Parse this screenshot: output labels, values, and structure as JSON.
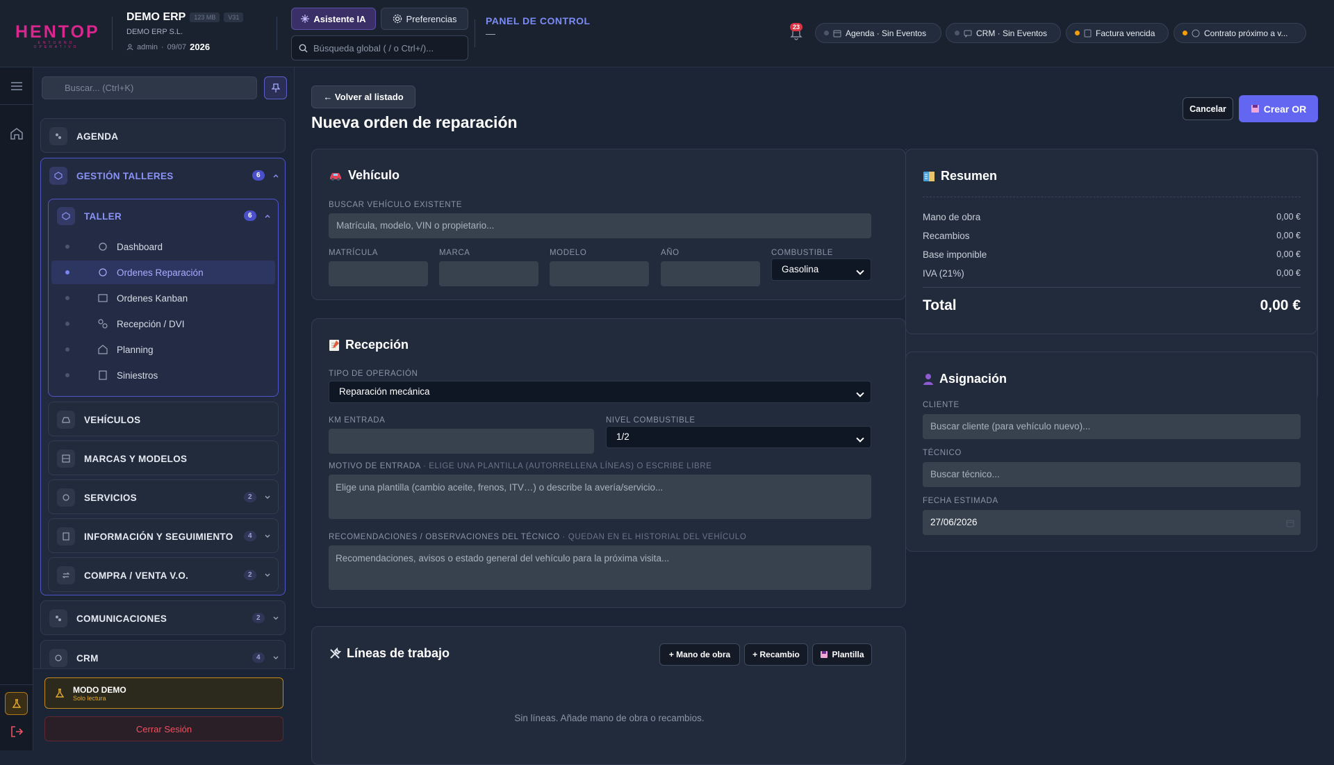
{
  "brand": {
    "logo": "HENTOP",
    "tagline": "ENTORNO OPERATIVO"
  },
  "erp": {
    "name": "DEMO ERP",
    "memory": "123 MB",
    "version": "V31",
    "company": "DEMO ERP S.L.",
    "user": "admin",
    "date": "09/07",
    "year": "2026"
  },
  "topbar": {
    "ai_button": "Asistente IA",
    "pref_button": "Preferencias",
    "search_placeholder": "Búsqueda global ( / o Ctrl+/)...",
    "panel_title": "PANEL DE CONTROL",
    "panel_sub": "—",
    "notifications": "23",
    "pills": [
      {
        "label": "Agenda · Sin Eventos",
        "dot": "#4c566a"
      },
      {
        "label": "CRM · Sin Eventos",
        "dot": "#4c566a"
      },
      {
        "label": "Factura vencida",
        "dot": "#f59e0b"
      },
      {
        "label": "Contrato próximo a v...",
        "dot": "#f59e0b"
      }
    ]
  },
  "sidebar": {
    "search_placeholder": "Buscar... (Ctrl+K)",
    "agenda": "AGENDA",
    "gestion": {
      "label": "GESTIÓN TALLERES",
      "count": "6"
    },
    "taller": {
      "label": "TALLER",
      "count": "6"
    },
    "taller_items": [
      "Dashboard",
      "Ordenes Reparación",
      "Ordenes Kanban",
      "Recepción / DVI",
      "Planning",
      "Siniestros"
    ],
    "vehiculos": "VEHÍCULOS",
    "marcas": "MARCAS Y MODELOS",
    "servicios": {
      "label": "SERVICIOS",
      "count": "2"
    },
    "informacion": {
      "label": "INFORMACIÓN Y SEGUIMIENTO",
      "count": "4"
    },
    "compraventa": {
      "label": "COMPRA / VENTA V.O.",
      "count": "2"
    },
    "comunicaciones": {
      "label": "COMUNICACIONES",
      "count": "2"
    },
    "crm": {
      "label": "CRM",
      "count": "4"
    },
    "demo_title": "MODO DEMO",
    "demo_sub": "Solo lectura",
    "logout": "Cerrar Sesión"
  },
  "main": {
    "back": "← Volver al listado",
    "title": "Nueva orden de reparación",
    "cancel": "Cancelar",
    "create": "Crear OR"
  },
  "vehiculo": {
    "title": "Vehículo",
    "search_label": "BUSCAR VEHÍCULO EXISTENTE",
    "search_placeholder": "Matrícula, modelo, VIN o propietario...",
    "matricula": "MATRÍCULA",
    "marca": "MARCA",
    "modelo": "MODELO",
    "anio": "AÑO",
    "combustible": "COMBUSTIBLE",
    "combustible_value": "Gasolina"
  },
  "recepcion": {
    "title": "Recepción",
    "tipo_label": "TIPO DE OPERACIÓN",
    "tipo_value": "Reparación mecánica",
    "km_label": "KM ENTRADA",
    "nivel_label": "NIVEL COMBUSTIBLE",
    "nivel_value": "1/2",
    "motivo_label": "MOTIVO DE ENTRADA",
    "motivo_hint": "· ELIGE UNA PLANTILLA (AUTORRELLENA LÍNEAS) O ESCRIBE LIBRE",
    "motivo_placeholder": "Elige una plantilla (cambio aceite, frenos, ITV…) o describe la avería/servicio...",
    "reco_label": "RECOMENDACIONES / OBSERVACIONES DEL TÉCNICO",
    "reco_hint": "· QUEDAN EN EL HISTORIAL DEL VEHÍCULO",
    "reco_placeholder": "Recomendaciones, avisos o estado general del vehículo para la próxima visita..."
  },
  "lineas": {
    "title": "Líneas de trabajo",
    "mano": "+ Mano de obra",
    "recambio": "+ Recambio",
    "plantilla": "Plantilla",
    "empty": "Sin líneas. Añade mano de obra o recambios."
  },
  "resumen": {
    "title": "Resumen",
    "rows": [
      {
        "label": "Mano de obra",
        "value": "0,00 €"
      },
      {
        "label": "Recambios",
        "value": "0,00 €"
      },
      {
        "label": "Base imponible",
        "value": "0,00 €"
      },
      {
        "label": "IVA (21%)",
        "value": "0,00 €"
      }
    ],
    "total_label": "Total",
    "total_value": "0,00 €"
  },
  "asignacion": {
    "title": "Asignación",
    "cliente_label": "CLIENTE",
    "cliente_placeholder": "Buscar cliente (para vehículo nuevo)...",
    "tecnico_label": "TÉCNICO",
    "tecnico_placeholder": "Buscar técnico...",
    "fecha_label": "FECHA ESTIMADA",
    "fecha_value": "27/06/2026"
  }
}
